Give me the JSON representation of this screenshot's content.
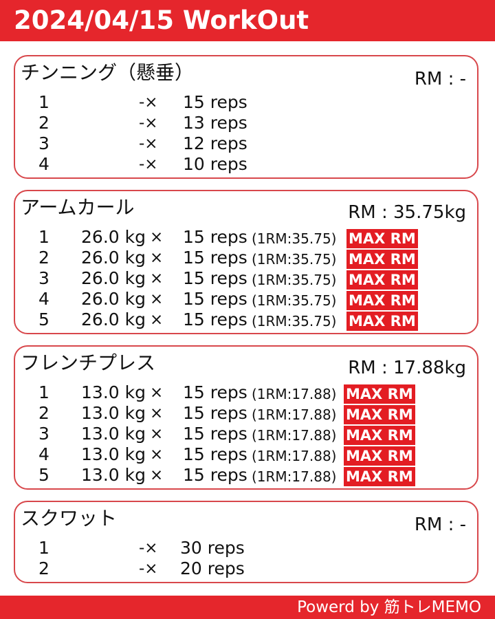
{
  "header": {
    "title": "2024/04/15 WorkOut"
  },
  "colors": {
    "accent": "#e5262c",
    "card_border": "#d8474b",
    "badge": "#e31d23"
  },
  "exercises": [
    {
      "name": "チンニング（懸垂）",
      "rm": "RM : -",
      "sets": [
        {
          "num": "1",
          "weight": "",
          "x": "-×",
          "reps": "15 reps",
          "one_rm": "",
          "badge": ""
        },
        {
          "num": "2",
          "weight": "",
          "x": "-×",
          "reps": "13 reps",
          "one_rm": "",
          "badge": ""
        },
        {
          "num": "3",
          "weight": "",
          "x": "-×",
          "reps": "12 reps",
          "one_rm": "",
          "badge": ""
        },
        {
          "num": "4",
          "weight": "",
          "x": "-×",
          "reps": "10 reps",
          "one_rm": "",
          "badge": ""
        }
      ]
    },
    {
      "name": "アームカール",
      "rm": "RM : 35.75kg",
      "sets": [
        {
          "num": "1",
          "weight": "26.0 kg",
          "x": "×",
          "reps": "15 reps",
          "one_rm": "(1RM:35.75)",
          "badge": "MAX RM"
        },
        {
          "num": "2",
          "weight": "26.0 kg",
          "x": "×",
          "reps": "15 reps",
          "one_rm": "(1RM:35.75)",
          "badge": "MAX RM"
        },
        {
          "num": "3",
          "weight": "26.0 kg",
          "x": "×",
          "reps": "15 reps",
          "one_rm": "(1RM:35.75)",
          "badge": "MAX RM"
        },
        {
          "num": "4",
          "weight": "26.0 kg",
          "x": "×",
          "reps": "15 reps",
          "one_rm": "(1RM:35.75)",
          "badge": "MAX RM"
        },
        {
          "num": "5",
          "weight": "26.0 kg",
          "x": "×",
          "reps": "15 reps",
          "one_rm": "(1RM:35.75)",
          "badge": "MAX RM"
        }
      ]
    },
    {
      "name": "フレンチプレス",
      "rm": "RM : 17.88kg",
      "sets": [
        {
          "num": "1",
          "weight": "13.0 kg",
          "x": "×",
          "reps": "15 reps",
          "one_rm": "(1RM:17.88)",
          "badge": "MAX RM"
        },
        {
          "num": "2",
          "weight": "13.0 kg",
          "x": "×",
          "reps": "15 reps",
          "one_rm": "(1RM:17.88)",
          "badge": "MAX RM"
        },
        {
          "num": "3",
          "weight": "13.0 kg",
          "x": "×",
          "reps": "15 reps",
          "one_rm": "(1RM:17.88)",
          "badge": "MAX RM"
        },
        {
          "num": "4",
          "weight": "13.0 kg",
          "x": "×",
          "reps": "15 reps",
          "one_rm": "(1RM:17.88)",
          "badge": "MAX RM"
        },
        {
          "num": "5",
          "weight": "13.0 kg",
          "x": "×",
          "reps": "15 reps",
          "one_rm": "(1RM:17.88)",
          "badge": "MAX RM"
        }
      ]
    },
    {
      "name": "スクワット",
      "rm": "RM : -",
      "sets": [
        {
          "num": "1",
          "weight": "",
          "x": "-×",
          "reps": "30 reps",
          "one_rm": "",
          "badge": ""
        },
        {
          "num": "2",
          "weight": "",
          "x": "-×",
          "reps": "20 reps",
          "one_rm": "",
          "badge": ""
        }
      ]
    }
  ],
  "footer": {
    "text": "Powerd by 筋トレMEMO"
  }
}
